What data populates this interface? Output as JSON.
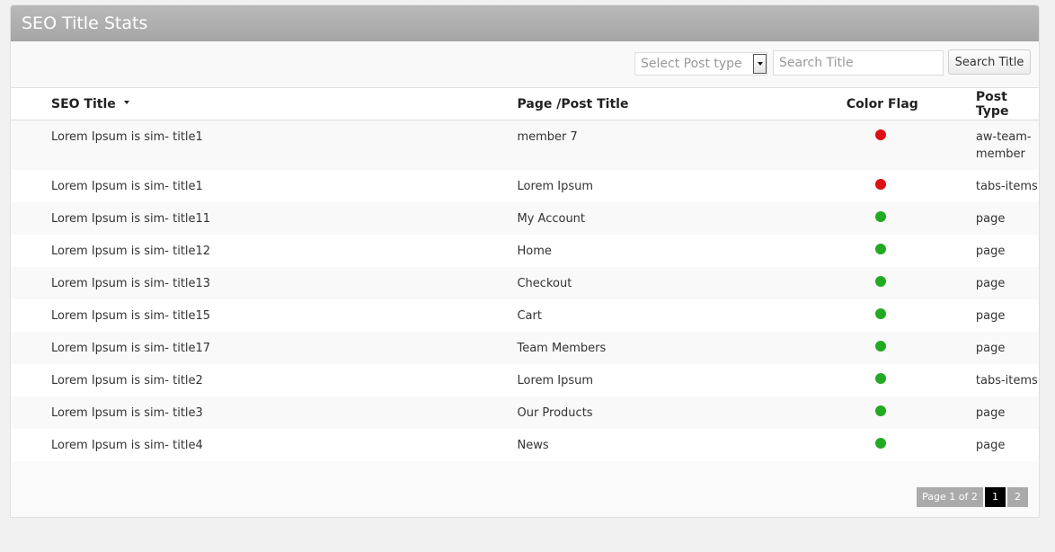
{
  "panel": {
    "title": "SEO Title Stats"
  },
  "toolbar": {
    "select_placeholder": "Select Post type",
    "search_placeholder": "Search Title",
    "search_button_label": "Search Title"
  },
  "table": {
    "columns": {
      "seo_title": "SEO Title",
      "page_title": "Page /Post Title",
      "color_flag": "Color Flag",
      "post_type": "Post Type"
    },
    "rows": [
      {
        "seo_title": "Lorem Ipsum is sim- title1",
        "page_title": "member 7",
        "flag": "red",
        "post_type": "aw-team-member"
      },
      {
        "seo_title": "Lorem Ipsum is sim- title1",
        "page_title": "Lorem Ipsum",
        "flag": "red",
        "post_type": "tabs-items"
      },
      {
        "seo_title": "Lorem Ipsum is sim- title11",
        "page_title": "My Account",
        "flag": "green",
        "post_type": "page"
      },
      {
        "seo_title": "Lorem Ipsum is sim- title12",
        "page_title": "Home",
        "flag": "green",
        "post_type": "page"
      },
      {
        "seo_title": "Lorem Ipsum is sim- title13",
        "page_title": "Checkout",
        "flag": "green",
        "post_type": "page"
      },
      {
        "seo_title": "Lorem Ipsum is sim- title15",
        "page_title": "Cart",
        "flag": "green",
        "post_type": "page"
      },
      {
        "seo_title": "Lorem Ipsum is sim- title17",
        "page_title": "Team Members",
        "flag": "green",
        "post_type": "page"
      },
      {
        "seo_title": "Lorem Ipsum is sim- title2",
        "page_title": "Lorem Ipsum",
        "flag": "green",
        "post_type": "tabs-items"
      },
      {
        "seo_title": "Lorem Ipsum is sim- title3",
        "page_title": "Our Products",
        "flag": "green",
        "post_type": "page"
      },
      {
        "seo_title": "Lorem Ipsum is sim- title4",
        "page_title": "News",
        "flag": "green",
        "post_type": "page"
      }
    ]
  },
  "pagination": {
    "info": "Page 1 of 2",
    "pages": [
      "1",
      "2"
    ],
    "current": "1"
  },
  "colors": {
    "red": "#dd1111",
    "green": "#22aa22"
  },
  "icons": {
    "sort": "sort-descending-icon",
    "dropdown": "chevron-down-icon"
  }
}
